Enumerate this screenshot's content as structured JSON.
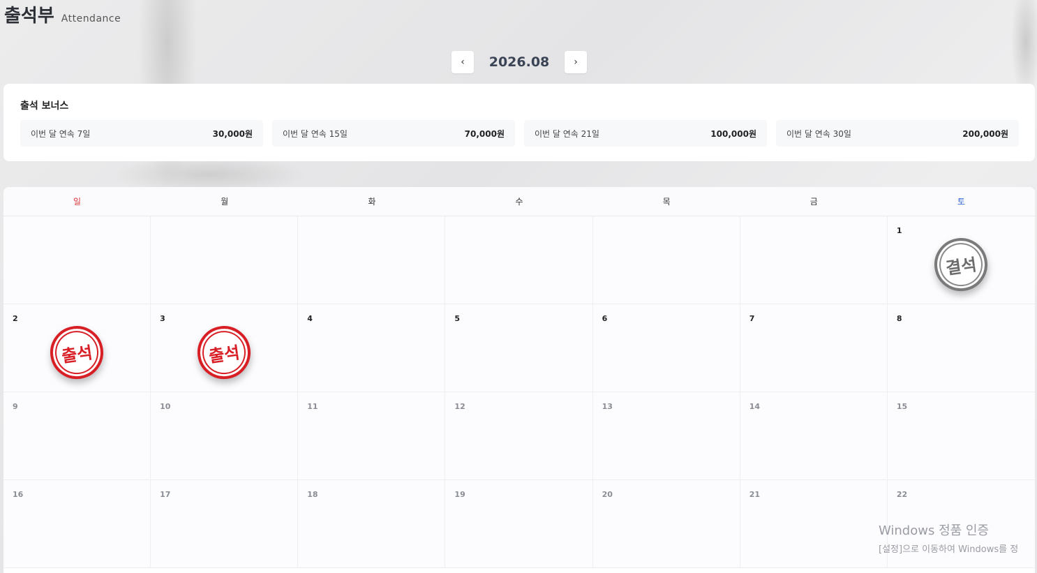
{
  "header": {
    "title": "출석부",
    "subtitle": "Attendance"
  },
  "month_nav": {
    "prev": "‹",
    "label": "2026.08",
    "next": "›"
  },
  "bonus": {
    "title": "출석 보너스",
    "items": [
      {
        "condition": "이번 달 연속 7일",
        "amount": "30,000원"
      },
      {
        "condition": "이번 달 연속 15일",
        "amount": "70,000원"
      },
      {
        "condition": "이번 달 연속 21일",
        "amount": "100,000원"
      },
      {
        "condition": "이번 달 연속 30일",
        "amount": "200,000원"
      }
    ]
  },
  "calendar": {
    "weekdays": [
      "일",
      "월",
      "화",
      "수",
      "목",
      "금",
      "토"
    ],
    "weeks": [
      [
        {
          "day": ""
        },
        {
          "day": ""
        },
        {
          "day": ""
        },
        {
          "day": ""
        },
        {
          "day": ""
        },
        {
          "day": ""
        },
        {
          "day": "1",
          "stamp": "결석"
        }
      ],
      [
        {
          "day": "2",
          "stamp": "출석"
        },
        {
          "day": "3",
          "stamp": "출석"
        },
        {
          "day": "4"
        },
        {
          "day": "5"
        },
        {
          "day": "6"
        },
        {
          "day": "7"
        },
        {
          "day": "8"
        }
      ],
      [
        {
          "day": "9"
        },
        {
          "day": "10"
        },
        {
          "day": "11"
        },
        {
          "day": "12"
        },
        {
          "day": "13"
        },
        {
          "day": "14"
        },
        {
          "day": "15"
        }
      ],
      [
        {
          "day": "16"
        },
        {
          "day": "17"
        },
        {
          "day": "18"
        },
        {
          "day": "19"
        },
        {
          "day": "20"
        },
        {
          "day": "21"
        },
        {
          "day": "22"
        }
      ]
    ]
  },
  "watermark": {
    "line1": "Windows 정품 인증",
    "line2": "[설정]으로 이동하여 Windows를 정"
  }
}
